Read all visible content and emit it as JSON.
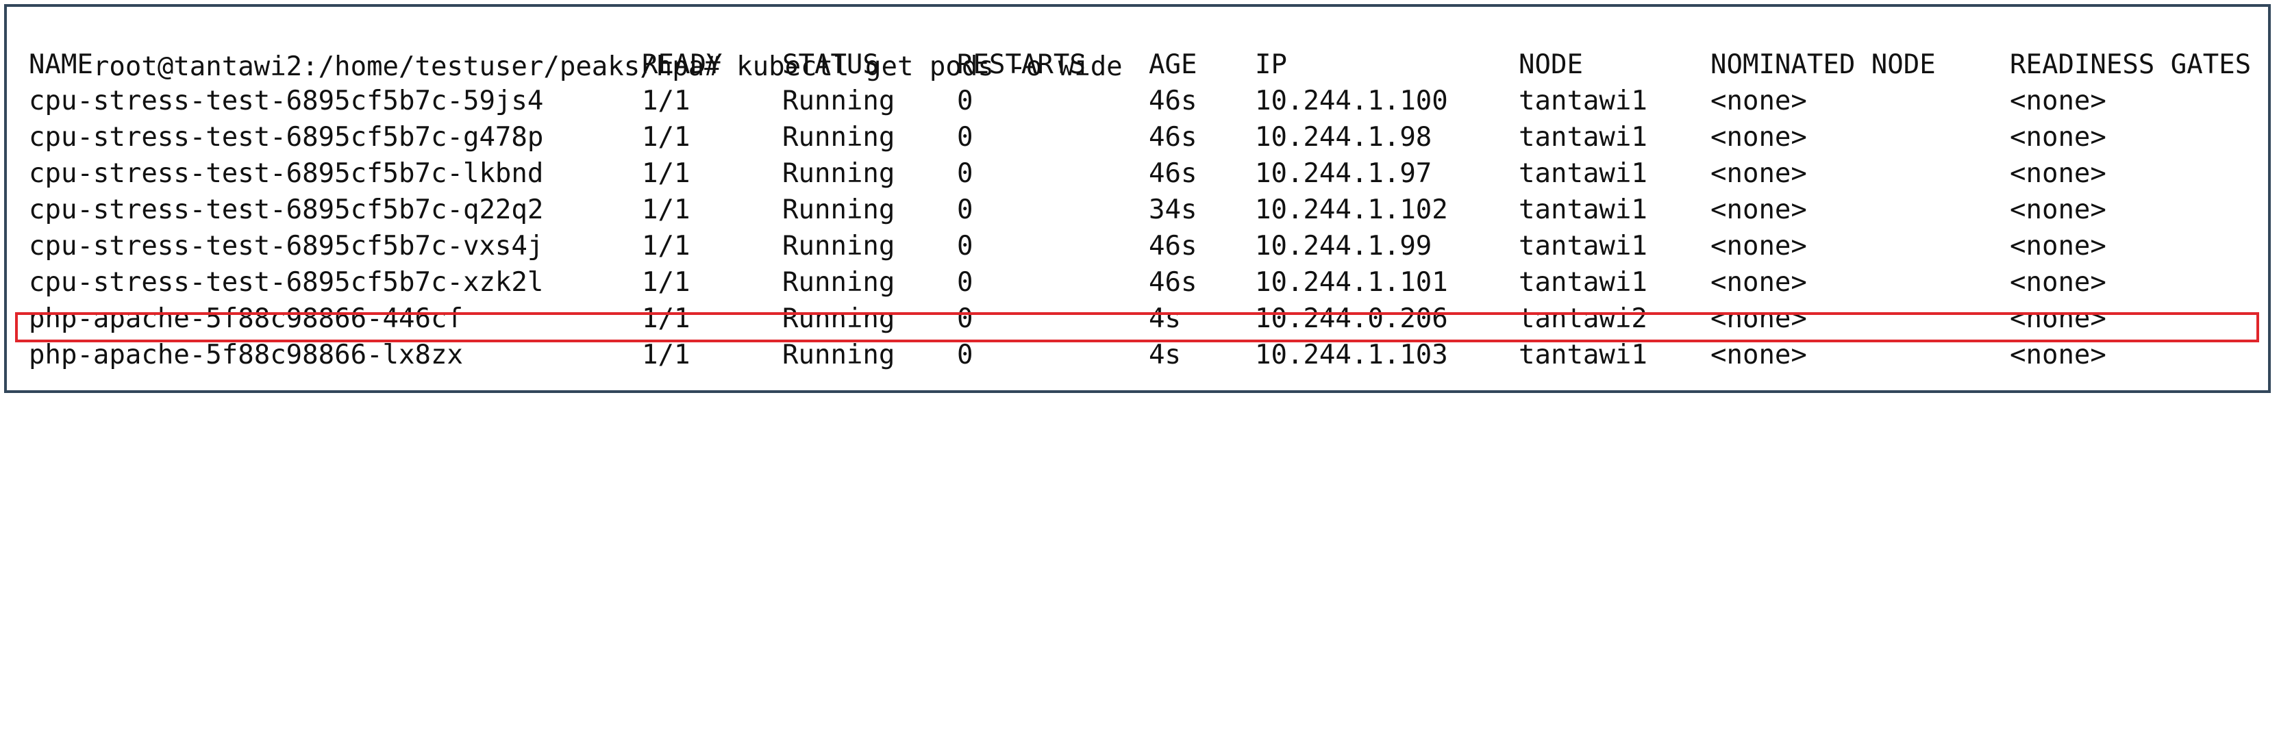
{
  "terminal": {
    "prompt": "root@tantawi2:/home/testuser/peaks/hpa#",
    "command": "kubectl get pods -o wide"
  },
  "table": {
    "headers": {
      "name": "NAME",
      "ready": "READY",
      "status": "STATUS",
      "restarts": "RESTARTS",
      "age": "AGE",
      "ip": "IP",
      "node": "NODE",
      "nominated": "NOMINATED NODE",
      "gates": "READINESS GATES"
    },
    "rows": [
      {
        "name": "cpu-stress-test-6895cf5b7c-59js4",
        "ready": "1/1",
        "status": "Running",
        "restarts": "0",
        "age": "46s",
        "ip": "10.244.1.100",
        "node": "tantawi1",
        "nominated": "<none>",
        "gates": "<none>"
      },
      {
        "name": "cpu-stress-test-6895cf5b7c-g478p",
        "ready": "1/1",
        "status": "Running",
        "restarts": "0",
        "age": "46s",
        "ip": "10.244.1.98",
        "node": "tantawi1",
        "nominated": "<none>",
        "gates": "<none>"
      },
      {
        "name": "cpu-stress-test-6895cf5b7c-lkbnd",
        "ready": "1/1",
        "status": "Running",
        "restarts": "0",
        "age": "46s",
        "ip": "10.244.1.97",
        "node": "tantawi1",
        "nominated": "<none>",
        "gates": "<none>"
      },
      {
        "name": "cpu-stress-test-6895cf5b7c-q22q2",
        "ready": "1/1",
        "status": "Running",
        "restarts": "0",
        "age": "34s",
        "ip": "10.244.1.102",
        "node": "tantawi1",
        "nominated": "<none>",
        "gates": "<none>"
      },
      {
        "name": "cpu-stress-test-6895cf5b7c-vxs4j",
        "ready": "1/1",
        "status": "Running",
        "restarts": "0",
        "age": "46s",
        "ip": "10.244.1.99",
        "node": "tantawi1",
        "nominated": "<none>",
        "gates": "<none>"
      },
      {
        "name": "cpu-stress-test-6895cf5b7c-xzk2l",
        "ready": "1/1",
        "status": "Running",
        "restarts": "0",
        "age": "46s",
        "ip": "10.244.1.101",
        "node": "tantawi1",
        "nominated": "<none>",
        "gates": "<none>"
      },
      {
        "name": "php-apache-5f88c98866-446cf",
        "ready": "1/1",
        "status": "Running",
        "restarts": "0",
        "age": "4s",
        "ip": "10.244.0.206",
        "node": "tantawi2",
        "nominated": "<none>",
        "gates": "<none>"
      },
      {
        "name": "php-apache-5f88c98866-lx8zx",
        "ready": "1/1",
        "status": "Running",
        "restarts": "0",
        "age": "4s",
        "ip": "10.244.1.103",
        "node": "tantawi1",
        "nominated": "<none>",
        "gates": "<none>"
      }
    ]
  },
  "highlight": {
    "color": "#e0262b",
    "row_index": 6
  }
}
